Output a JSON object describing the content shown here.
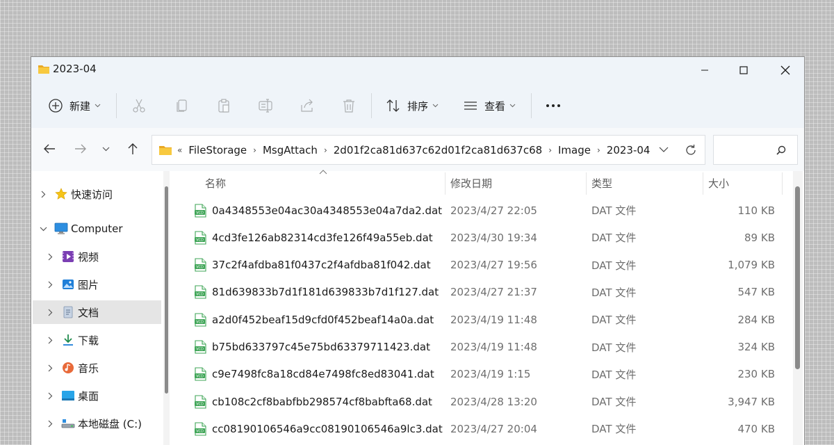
{
  "window": {
    "title": "2023-04",
    "controls": {
      "minimize": "minimize-icon",
      "maximize": "maximize-icon",
      "close": "close-icon"
    }
  },
  "toolbar": {
    "new_label": "新建",
    "sort_label": "排序",
    "view_label": "查看",
    "icons": [
      "plus-circle-icon",
      "cut-icon",
      "copy-icon",
      "paste-icon",
      "rename-icon",
      "share-icon",
      "delete-icon",
      "sort-icon",
      "view-icon",
      "more-icon"
    ]
  },
  "address": {
    "prefix": "«",
    "crumbs": [
      "FileStorage",
      "MsgAttach",
      "2d01f2ca81d637c62d01f2ca81d637c68",
      "Image",
      "2023-04"
    ]
  },
  "sidebar": {
    "items": [
      {
        "label": "快速访问",
        "icon": "star-icon",
        "expanded": false
      },
      {
        "label": "Computer",
        "icon": "monitor-icon",
        "expanded": true
      },
      {
        "label": "视频",
        "icon": "video-icon",
        "expanded": false
      },
      {
        "label": "图片",
        "icon": "pictures-icon",
        "expanded": false
      },
      {
        "label": "文档",
        "icon": "documents-icon",
        "expanded": false,
        "selected": true
      },
      {
        "label": "下载",
        "icon": "download-icon",
        "expanded": false
      },
      {
        "label": "音乐",
        "icon": "music-icon",
        "expanded": false
      },
      {
        "label": "桌面",
        "icon": "desktop-icon",
        "expanded": false
      },
      {
        "label": "本地磁盘 (C:)",
        "icon": "drive-icon",
        "expanded": false
      }
    ]
  },
  "columns": {
    "name": "名称",
    "date": "修改日期",
    "type": "类型",
    "size": "大小"
  },
  "files": [
    {
      "name": "0a4348553e04ac30a4348553e04a7da2.dat",
      "date": "2023/4/27 22:05",
      "type": "DAT 文件",
      "size": "110 KB"
    },
    {
      "name": "4cd3fe126ab82314cd3fe126f49a55eb.dat",
      "date": "2023/4/30 19:34",
      "type": "DAT 文件",
      "size": "89 KB"
    },
    {
      "name": "37c2f4afdba81f0437c2f4afdba81f042.dat",
      "date": "2023/4/27 19:56",
      "type": "DAT 文件",
      "size": "1,079 KB"
    },
    {
      "name": "81d639833b7d1f181d639833b7d1f127.dat",
      "date": "2023/4/27 21:37",
      "type": "DAT 文件",
      "size": "547 KB"
    },
    {
      "name": "a2d0f452beaf15d9cfd0f452beaf14a0a.dat",
      "date": "2023/4/19 11:48",
      "type": "DAT 文件",
      "size": "284 KB"
    },
    {
      "name": "b75bd633797c45e75bd63379711423.dat",
      "date": "2023/4/19 11:48",
      "type": "DAT 文件",
      "size": "324 KB"
    },
    {
      "name": "c9e7498fc8a18cd84e7498fc8ed83041.dat",
      "date": "2023/4/19 1:15",
      "type": "DAT 文件",
      "size": "230 KB"
    },
    {
      "name": "cb108c2cf8babfbb298574cf8babfta68.dat",
      "date": "2023/4/28 13:20",
      "type": "DAT 文件",
      "size": "3,947 KB"
    },
    {
      "name": "cc08190106546a9cc08190106546a9lc3.dat",
      "date": "2023/4/27 20:04",
      "type": "DAT 文件",
      "size": "470 KB"
    }
  ],
  "colors": {
    "accent": "#0067c0",
    "folder": "#f3c13a",
    "file_icon": "#3fa557"
  }
}
